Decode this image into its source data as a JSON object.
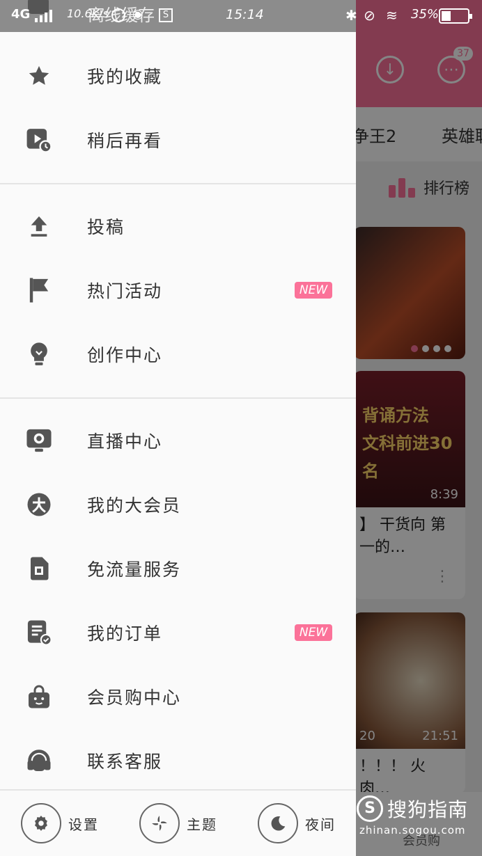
{
  "status_bar": {
    "network": "4G",
    "speed": "10.6K/s",
    "time": "15:14",
    "battery": "35%",
    "battery_level_percent": 35
  },
  "offline_cache": {
    "label": "离线缓存"
  },
  "background": {
    "tabs": [
      "争王2",
      "英雄联"
    ],
    "rank_label": "排行榜",
    "message_badge": "37",
    "card1": {
      "overlay_line1": "背诵方法",
      "overlay_line2": "文科前进30名",
      "duration": "8:39",
      "title": "】 干货向 第一的…"
    },
    "card2": {
      "duration": "21:51",
      "title": "！！！ 火 肉…",
      "left_count": "20"
    },
    "nav_label": "会员购"
  },
  "drawer": {
    "group1": [
      {
        "label": "我的收藏",
        "icon": "star-icon"
      },
      {
        "label": "稍后再看",
        "icon": "watch-later-icon"
      }
    ],
    "group2": [
      {
        "label": "投稿",
        "icon": "upload-icon"
      },
      {
        "label": "热门活动",
        "icon": "flag-icon",
        "badge": "NEW"
      },
      {
        "label": "创作中心",
        "icon": "lightbulb-icon"
      }
    ],
    "group3": [
      {
        "label": "直播中心",
        "icon": "live-camera-icon"
      },
      {
        "label": "我的大会员",
        "icon": "big-member-icon"
      },
      {
        "label": "免流量服务",
        "icon": "sim-card-icon"
      },
      {
        "label": "我的订单",
        "icon": "order-icon",
        "badge": "NEW"
      },
      {
        "label": "会员购中心",
        "icon": "shopping-bag-icon"
      },
      {
        "label": "联系客服",
        "icon": "headset-icon"
      }
    ],
    "footer": {
      "settings": "设置",
      "theme": "主题",
      "night": "夜间"
    }
  },
  "watermark": {
    "title": "搜狗指南",
    "url": "zhinan.sogou.com"
  },
  "colors": {
    "accent": "#fb7299",
    "drawer_bg": "#fafafa",
    "icon": "#555555",
    "text": "#333333"
  }
}
